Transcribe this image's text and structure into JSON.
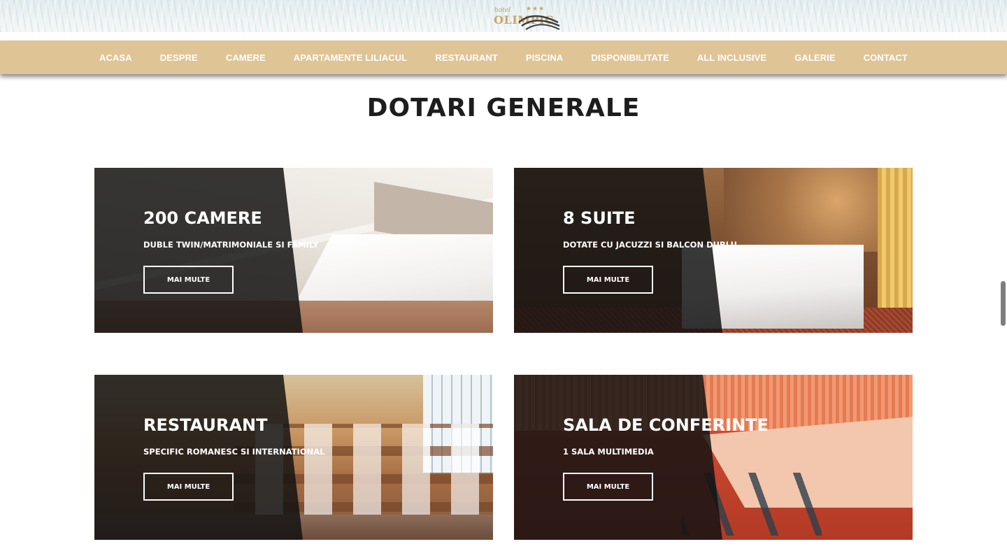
{
  "header": {
    "logo": {
      "small_text": "hotel",
      "main_text": "OLIMPIC",
      "stars": "★★★"
    }
  },
  "nav": {
    "items": [
      "ACASA",
      "DESPRE",
      "CAMERE",
      "APARTAMENTE LILIACUL",
      "RESTAURANT",
      "PISCINA",
      "DISPONIBILITATE",
      "ALL INCLUSIVE",
      "GALERIE",
      "CONTACT"
    ]
  },
  "section": {
    "title": "DOTARI GENERALE"
  },
  "cards": [
    {
      "title": "200 CAMERE",
      "subtitle": "DUBLE TWIN/MATRIMONIALE SI FAMILY",
      "button": "MAI MULTE"
    },
    {
      "title": "8 SUITE",
      "subtitle": "DOTATE CU JACUZZI SI BALCON DUBLU",
      "button": "MAI MULTE"
    },
    {
      "title": "RESTAURANT",
      "subtitle": "SPECIFIC ROMANESC SI INTERNATIONAL",
      "button": "MAI MULTE"
    },
    {
      "title": "SALA DE CONFERINTE",
      "subtitle": "1 SALA MULTIMEDIA",
      "button": "MAI MULTE"
    }
  ],
  "colors": {
    "nav_background": "#dfc496",
    "card_overlay": "#121212",
    "heading": "#1d1d1d"
  }
}
